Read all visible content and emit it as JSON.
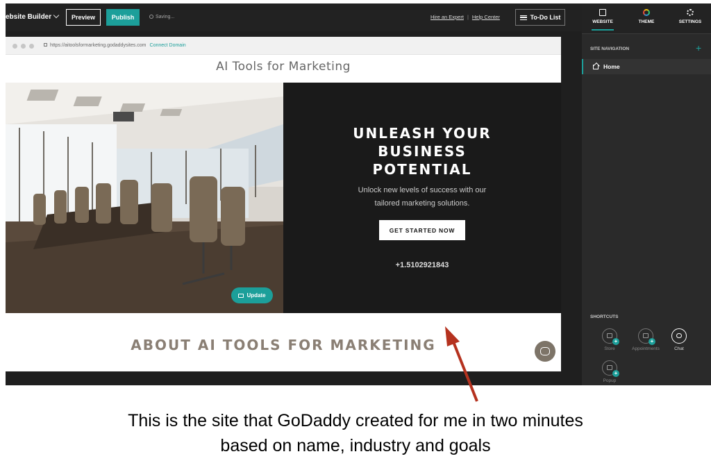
{
  "topbar": {
    "builder_title": "ebsite Builder",
    "preview_label": "Preview",
    "publish_label": "Publish",
    "saving_text": "Saving...",
    "hire_expert": "Hire an Expert",
    "help_center": "Help Center",
    "todo_label": "To-Do List"
  },
  "browser": {
    "url": "https://aitoolsformarketing.godaddysites.com",
    "connect_domain": "Connect Domain"
  },
  "site": {
    "title": "AI Tools for Marketing",
    "hero_heading": [
      "UNLEASH YOUR",
      "BUSINESS",
      "POTENTIAL"
    ],
    "hero_sub": [
      "Unlock new levels of success with our",
      "tailored marketing solutions."
    ],
    "cta_label": "GET STARTED NOW",
    "phone": "+1.5102921843",
    "update_label": "Update",
    "about_heading": "ABOUT AI TOOLS FOR MARKETING"
  },
  "panel": {
    "tabs": [
      {
        "label": "WEBSITE",
        "icon": "website-icon"
      },
      {
        "label": "THEME",
        "icon": "theme-icon"
      },
      {
        "label": "SETTINGS",
        "icon": "gear-icon"
      }
    ],
    "nav_header": "SITE NAVIGATION",
    "nav_items": [
      {
        "label": "Home",
        "icon": "home-icon"
      }
    ],
    "shortcuts_header": "SHORTCUTS",
    "shortcuts": [
      {
        "label": "Store",
        "icon": "store-icon"
      },
      {
        "label": "Appointments",
        "icon": "calendar-icon"
      },
      {
        "label": "Chat",
        "icon": "chat-icon"
      },
      {
        "label": "Popup",
        "icon": "popup-icon"
      }
    ]
  },
  "annotation": {
    "caption_lines": [
      "This is the site that GoDaddy created for me in two minutes",
      "based on name, industry and goals"
    ],
    "arrow_color": "#b5321f"
  },
  "colors": {
    "accent": "#1c9f9a",
    "dark_bg": "#1f1f1f",
    "about_text": "#8a7f74"
  }
}
